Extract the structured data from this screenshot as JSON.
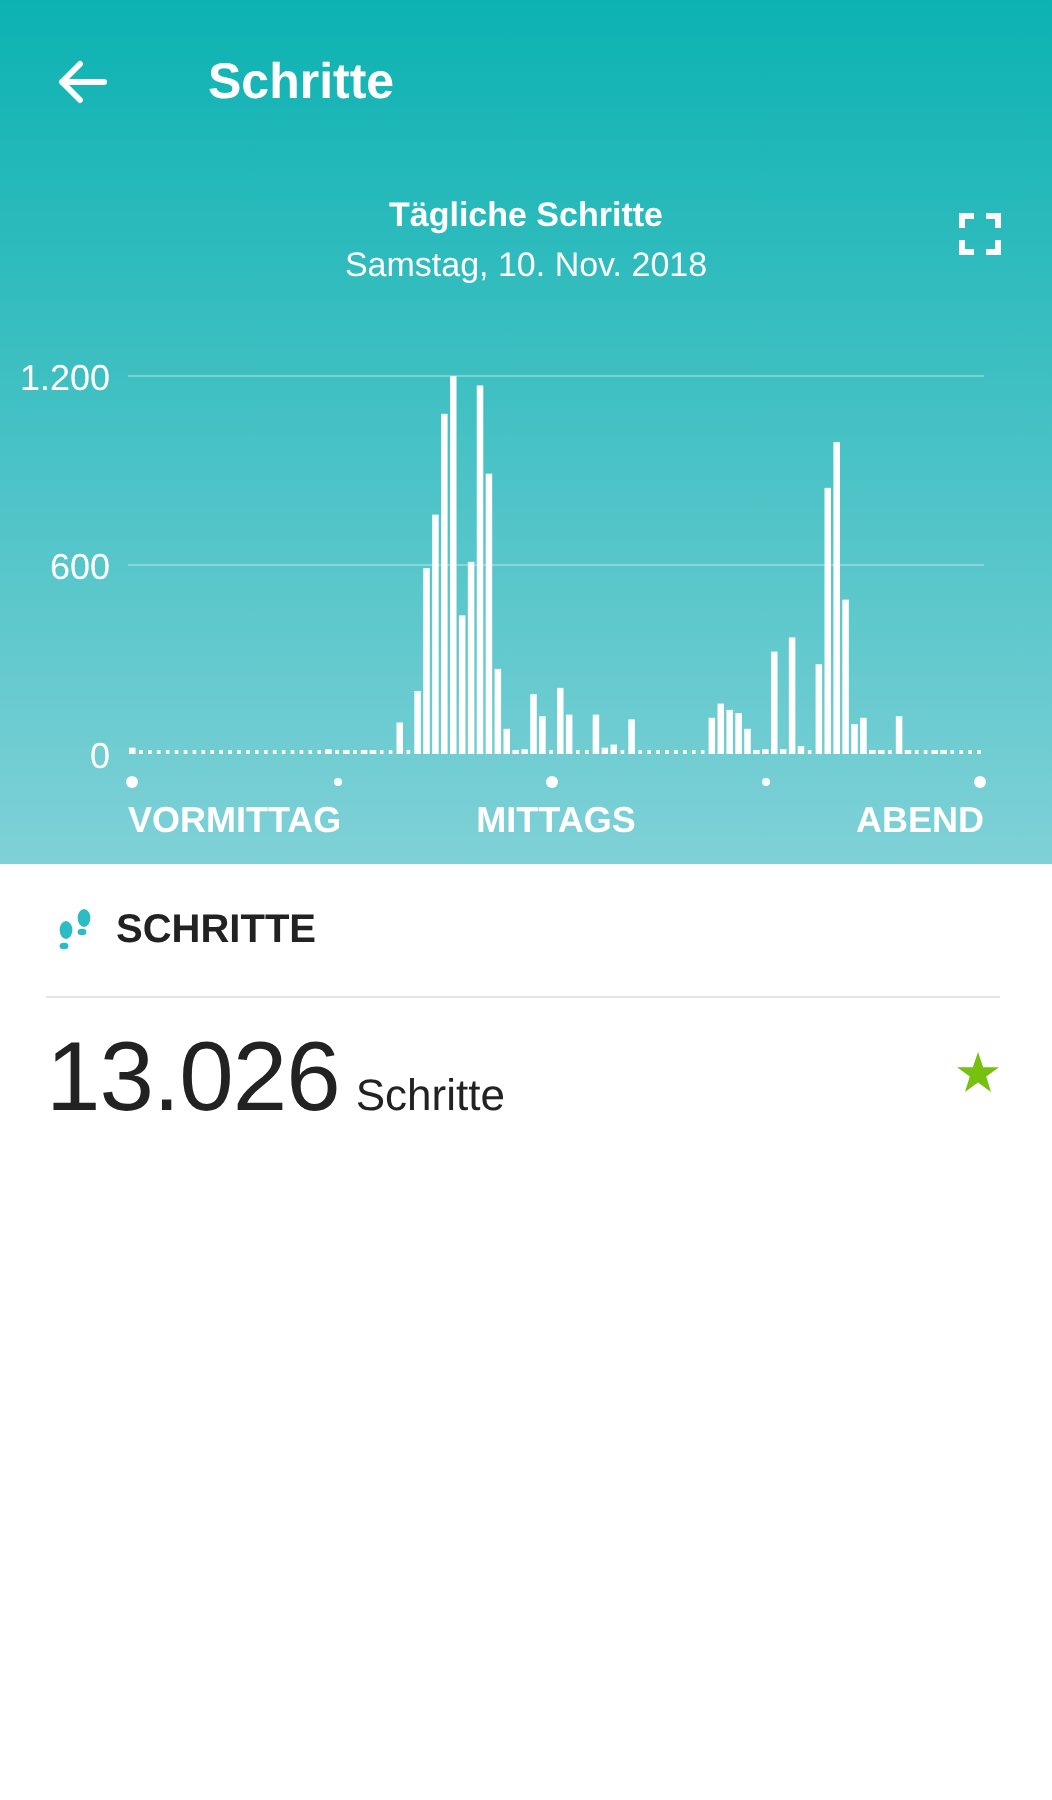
{
  "header": {
    "title": "Schritte"
  },
  "chart": {
    "title": "Tägliche Schritte",
    "subtitle": "Samstag, 10. Nov. 2018",
    "axis_labels": [
      "VORMITTAG",
      "MITTAGS",
      "ABEND"
    ],
    "chart_data": {
      "type": "bar",
      "ylim": [
        0,
        1200
      ],
      "yticks": [
        {
          "value": 0,
          "label": "0"
        },
        {
          "value": 600,
          "label": "600"
        },
        {
          "value": 1200,
          "label": "1.200"
        }
      ],
      "values": [
        20,
        0,
        0,
        0,
        0,
        0,
        0,
        0,
        0,
        0,
        0,
        0,
        0,
        0,
        0,
        0,
        0,
        0,
        0,
        0,
        0,
        0,
        15,
        0,
        10,
        0,
        10,
        5,
        0,
        0,
        100,
        0,
        200,
        590,
        760,
        1080,
        1200,
        440,
        610,
        1170,
        890,
        270,
        80,
        5,
        15,
        190,
        120,
        0,
        210,
        125,
        0,
        0,
        125,
        20,
        30,
        0,
        110,
        0,
        0,
        0,
        0,
        0,
        0,
        0,
        0,
        115,
        160,
        140,
        130,
        80,
        10,
        15,
        325,
        15,
        370,
        25,
        0,
        285,
        845,
        990,
        490,
        95,
        115,
        5,
        5,
        0,
        120,
        5,
        0,
        0,
        10,
        5,
        0,
        0,
        0,
        0
      ]
    }
  },
  "steps": {
    "section_title": "SCHRITTE",
    "value": "13.026",
    "unit": "Schritte",
    "goal_reached": true
  }
}
